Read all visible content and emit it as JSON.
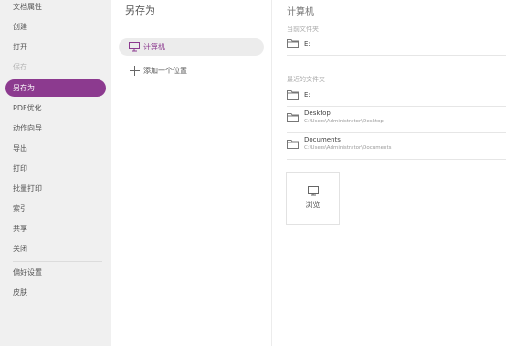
{
  "nav": {
    "items": [
      {
        "label": "文档属性",
        "state": "normal"
      },
      {
        "label": "创建",
        "state": "normal"
      },
      {
        "label": "打开",
        "state": "normal"
      },
      {
        "label": "保存",
        "state": "disabled"
      },
      {
        "label": "另存为",
        "state": "active"
      },
      {
        "label": "PDF优化",
        "state": "normal"
      },
      {
        "label": "动作向导",
        "state": "normal"
      },
      {
        "label": "导出",
        "state": "normal"
      },
      {
        "label": "打印",
        "state": "normal"
      },
      {
        "label": "批量打印",
        "state": "normal"
      },
      {
        "label": "索引",
        "state": "normal"
      },
      {
        "label": "共享",
        "state": "normal"
      },
      {
        "label": "关闭",
        "state": "normal"
      },
      {
        "label": "偏好设置",
        "state": "normal"
      },
      {
        "label": "皮肤",
        "state": "normal"
      }
    ]
  },
  "middle": {
    "title": "另存为",
    "selected_place": "计算机",
    "add_place": "添加一个位置"
  },
  "right": {
    "title": "计算机",
    "current_folder_label": "当前文件夹",
    "current_folder": {
      "name": "E:"
    },
    "recent_label": "最近的文件夹",
    "recent": [
      {
        "name": "E:",
        "path": ""
      },
      {
        "name": "Desktop",
        "path": "C:\\Users\\Administrator\\Desktop"
      },
      {
        "name": "Documents",
        "path": "C:\\Users\\Administrator\\Documents"
      }
    ],
    "browse_label": "浏览"
  },
  "colors": {
    "accent": "#8c3a8f",
    "nav_bg": "#f0f0f0",
    "selected_bg": "#ececec"
  },
  "icons": {
    "computer": "computer-icon",
    "add": "plus-icon",
    "folder": "folder-icon",
    "browse": "monitor-icon"
  }
}
